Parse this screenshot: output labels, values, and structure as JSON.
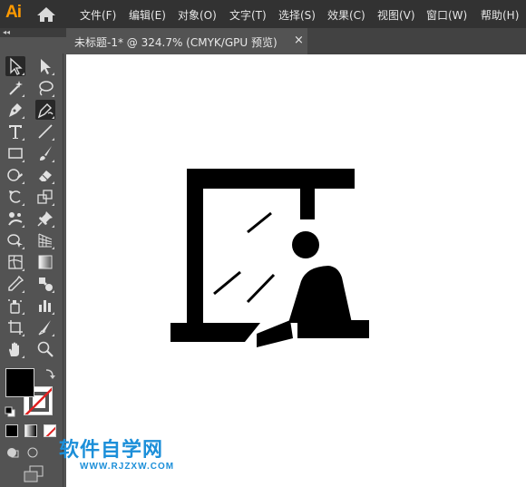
{
  "app": {
    "logo": "Ai",
    "menu": [
      "文件(F)",
      "编辑(E)",
      "对象(O)",
      "文字(T)",
      "选择(S)",
      "效果(C)",
      "视图(V)",
      "窗口(W)",
      "帮助(H)"
    ]
  },
  "panel": {
    "collapse_glyph": "◂◂"
  },
  "tab": {
    "label": "未标题-1* @ 324.7% (CMYK/GPU 预览)",
    "close": "×"
  },
  "tools": [
    {
      "name": "selection-tool",
      "icon": "arrow-outline-icon",
      "active": true
    },
    {
      "name": "direct-selection-tool",
      "icon": "arrow-solid-icon"
    },
    {
      "name": "magic-wand-tool",
      "icon": "magic-wand-icon"
    },
    {
      "name": "lasso-tool",
      "icon": "lasso-icon"
    },
    {
      "name": "pen-tool",
      "icon": "pen-icon"
    },
    {
      "name": "curvature-tool",
      "icon": "curvature-pen-icon",
      "active": true
    },
    {
      "name": "type-tool",
      "icon": "type-icon"
    },
    {
      "name": "line-tool",
      "icon": "line-icon"
    },
    {
      "name": "rectangle-tool",
      "icon": "rectangle-icon"
    },
    {
      "name": "paintbrush-tool",
      "icon": "brush-icon"
    },
    {
      "name": "shaper-tool",
      "icon": "shaper-icon"
    },
    {
      "name": "eraser-tool",
      "icon": "eraser-icon"
    },
    {
      "name": "rotate-tool",
      "icon": "rotate-icon"
    },
    {
      "name": "scale-tool",
      "icon": "scale-icon"
    },
    {
      "name": "puppet-warp-tool",
      "icon": "puppet-warp-icon"
    },
    {
      "name": "pin-tool",
      "icon": "pin-icon"
    },
    {
      "name": "shape-builder-tool",
      "icon": "shape-builder-icon"
    },
    {
      "name": "perspective-grid-tool",
      "icon": "perspective-grid-icon"
    },
    {
      "name": "mesh-tool",
      "icon": "mesh-icon"
    },
    {
      "name": "gradient-tool",
      "icon": "gradient-icon"
    },
    {
      "name": "eyedropper-tool",
      "icon": "eyedropper-icon"
    },
    {
      "name": "blend-tool",
      "icon": "blend-icon"
    },
    {
      "name": "symbol-sprayer-tool",
      "icon": "symbol-sprayer-icon"
    },
    {
      "name": "column-graph-tool",
      "icon": "column-graph-icon"
    },
    {
      "name": "artboard-tool",
      "icon": "artboard-icon"
    },
    {
      "name": "slice-tool",
      "icon": "slice-icon"
    },
    {
      "name": "hand-tool",
      "icon": "hand-icon"
    },
    {
      "name": "zoom-tool",
      "icon": "zoom-icon"
    }
  ],
  "colors": {
    "fill": "#000000",
    "stroke": "none",
    "accent": "#ff9a00",
    "watermark": "#1c8fd9"
  },
  "watermark": {
    "title": "软件自学网",
    "url": "WWW.RJZXW.COM"
  }
}
